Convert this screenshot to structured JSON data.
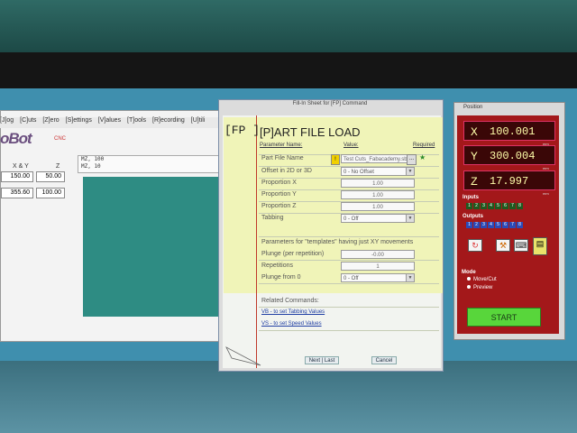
{
  "shopbot": {
    "menu": [
      "[J]og",
      "[C]uts",
      "[Z]ero",
      "[S]ettings",
      "[V]alues",
      "[T]ools",
      "[R]ecording",
      "[U]tili"
    ],
    "logo": "oBot",
    "logo_sub": "CNC",
    "xy_label": "X & Y",
    "z_label": "Z",
    "x1": "150.00",
    "z1": "50.00",
    "x2": "355.60",
    "z2": "100.00",
    "log": [
      "MZ, 100",
      "MZ, 10"
    ]
  },
  "dialog": {
    "title": "Fill-In Sheet for [FP] Command",
    "code": "[FP ]",
    "heading": "[P]ART FILE LOAD",
    "col_name": "Parameter Name:",
    "col_value": "Value:",
    "col_required": "Required",
    "params": [
      {
        "label": "Part File Name",
        "value": "Test Cuts_Fabacademy.sb"
      },
      {
        "label": "Offset in 2D or 3D",
        "value": "0 - No Offset"
      },
      {
        "label": "Proportion X",
        "value": "1.00"
      },
      {
        "label": "Proportion Y",
        "value": "1.00"
      },
      {
        "label": "Proportion Z",
        "value": "1.00"
      },
      {
        "label": "Tabbing",
        "value": "0 - Off"
      }
    ],
    "section2": "Parameters for \"templates\" having just XY movements",
    "params2": [
      {
        "label": "Plunge (per repetition)",
        "value": "-0.00"
      },
      {
        "label": "Repetitions",
        "value": "1"
      },
      {
        "label": "Plunge from 0",
        "value": "0 - Off"
      }
    ],
    "related": "Related Commands:",
    "links": [
      "VB - to set Tabbing Values",
      "VS - to set Speed Values"
    ],
    "next_button": "Next | Last",
    "cancel_button": "Cancel"
  },
  "position": {
    "title": "Position",
    "x_axis": "X",
    "x_value": "100.001",
    "y_axis": "Y",
    "y_value": "300.004",
    "z_axis": "Z",
    "z_value": "17.997",
    "unit": "mm",
    "inputs_label": "Inputs",
    "outputs_label": "Outputs",
    "inputs": [
      "1",
      "2",
      "3",
      "4",
      "5",
      "6",
      "7",
      "8"
    ],
    "outputs": [
      "1",
      "2",
      "3",
      "4",
      "5",
      "6",
      "7",
      "8"
    ],
    "mode_label": "Mode",
    "mode_options": [
      "Move/Cut",
      "Preview"
    ],
    "start_button": "START"
  },
  "colors": {
    "accent_red": "#a3181a",
    "start_green": "#58d63b",
    "dialog_yellow": "#f0f4b8"
  }
}
